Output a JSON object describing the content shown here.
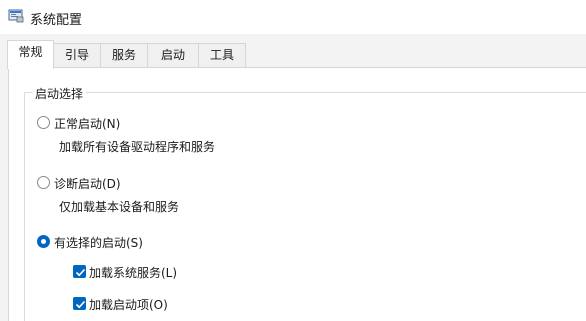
{
  "window": {
    "title": "系统配置"
  },
  "tabs": [
    {
      "label": "常规",
      "active": true
    },
    {
      "label": "引导",
      "active": false
    },
    {
      "label": "服务",
      "active": false
    },
    {
      "label": "启动",
      "active": false
    },
    {
      "label": "工具",
      "active": false
    }
  ],
  "startup_selection": {
    "legend": "启动选择",
    "normal": {
      "label": "正常启动(N)",
      "description": "加载所有设备驱动程序和服务",
      "selected": false
    },
    "diagnostic": {
      "label": "诊断启动(D)",
      "description": "仅加载基本设备和服务",
      "selected": false
    },
    "selective": {
      "label": "有选择的启动(S)",
      "selected": true,
      "options": [
        {
          "label": "加载系统服务(L)",
          "checked": true
        },
        {
          "label": "加载启动项(O)",
          "checked": true
        }
      ]
    }
  },
  "colors": {
    "accent": "#0067c0",
    "window_bg": "#f3f3f3",
    "panel_bg": "#ffffff"
  }
}
